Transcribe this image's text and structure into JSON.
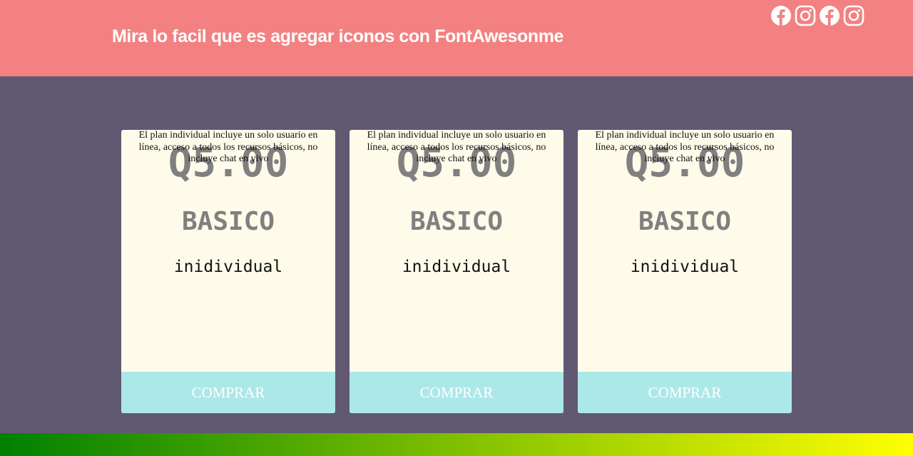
{
  "header": {
    "title": "Mira lo facil que es agregar iconos con FontAwesonme",
    "social_icons": [
      "facebook-icon",
      "instagram-icon",
      "facebook-icon",
      "instagram-icon"
    ]
  },
  "cards": [
    {
      "price": "Q5.00",
      "plan_name": "BASICO",
      "plan_type": "inidividual",
      "description": "El plan individual incluye un solo usuario en línea, acceso a todos los recursos básicos, no incluye chat en vivo",
      "button_label": "COMPRAR"
    },
    {
      "price": "Q5.00",
      "plan_name": "BASICO",
      "plan_type": "inidividual",
      "description": "El plan individual incluye un solo usuario en línea, acceso a todos los recursos básicos, no incluye chat en vivo",
      "button_label": "COMPRAR"
    },
    {
      "price": "Q5.00",
      "plan_name": "BASICO",
      "plan_type": "inidividual",
      "description": "El plan individual incluye un solo usuario en línea, acceso a todos los recursos básicos, no incluye chat en vivo",
      "button_label": "COMPRAR"
    }
  ],
  "colors": {
    "header_bg": "#f38181",
    "page_bg": "#615872",
    "card_bg": "#fefbea",
    "button_bg": "#ade8e8",
    "footer_gradient_start": "#008000",
    "footer_gradient_end": "#ffff00"
  }
}
